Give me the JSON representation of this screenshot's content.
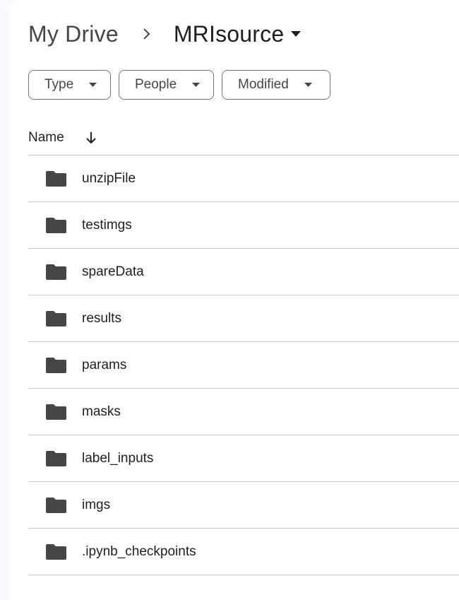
{
  "breadcrumb": {
    "root": "My Drive",
    "current": "MRIsource"
  },
  "filters": {
    "type": "Type",
    "people": "People",
    "modified": "Modified"
  },
  "list": {
    "column_name": "Name",
    "sort": "descending",
    "items": [
      {
        "name": "unzipFile",
        "kind": "folder"
      },
      {
        "name": "testimgs",
        "kind": "folder"
      },
      {
        "name": "spareData",
        "kind": "folder"
      },
      {
        "name": "results",
        "kind": "folder"
      },
      {
        "name": "params",
        "kind": "folder"
      },
      {
        "name": "masks",
        "kind": "folder"
      },
      {
        "name": "label_inputs",
        "kind": "folder"
      },
      {
        "name": "imgs",
        "kind": "folder"
      },
      {
        "name": ".ipynb_checkpoints",
        "kind": "folder"
      }
    ]
  },
  "colors": {
    "background": "#f8fafd",
    "panel": "#ffffff",
    "text": "#1f1f1f",
    "muted_text": "#444746",
    "folder_icon": "#444746",
    "divider": "#c4c7c5"
  }
}
